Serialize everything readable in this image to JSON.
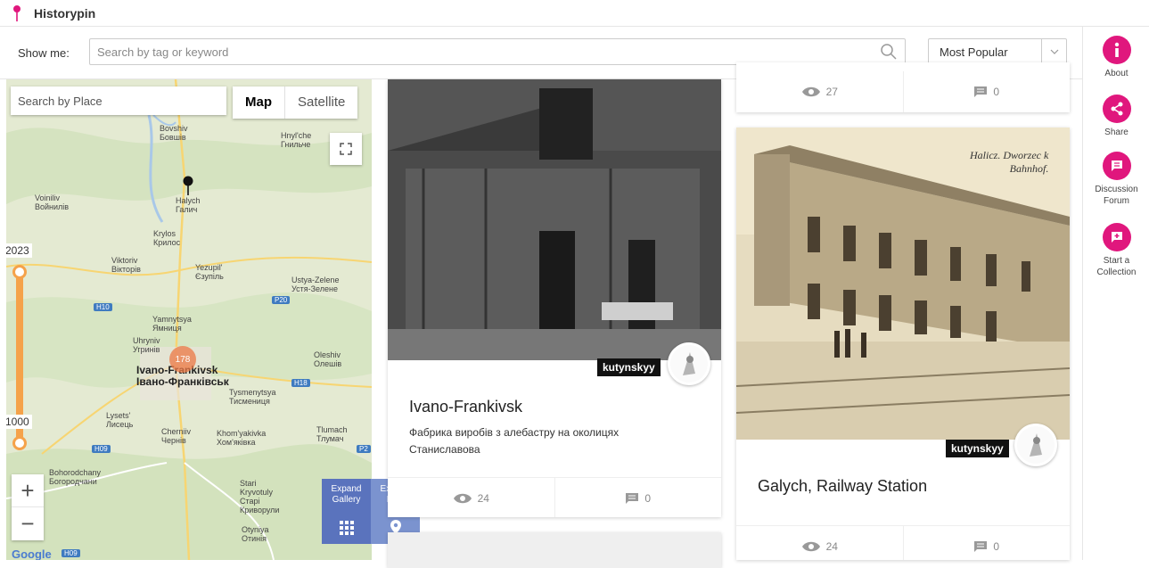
{
  "app": {
    "title": "Historypin"
  },
  "search": {
    "label": "Show me:",
    "placeholder": "Search by tag or keyword",
    "sort_value": "Most Popular"
  },
  "rail": [
    {
      "label": "About",
      "icon": "info-icon"
    },
    {
      "label": "Share",
      "icon": "share-icon"
    },
    {
      "label": "Discussion\nForum",
      "icon": "chat-icon"
    },
    {
      "label": "Start a\nCollection",
      "icon": "add-collection-icon"
    }
  ],
  "map": {
    "place_search_placeholder": "Search by Place",
    "type_map": "Map",
    "type_satellite": "Satellite",
    "year_top": "2023",
    "year_bottom": "1000",
    "cluster_count": "178",
    "google": "Google",
    "places": [
      "Bovshiv\nБовшів",
      "Hnyl'che\nГнильче",
      "Voiniliv\nВойнилів",
      "Halych\nГалич",
      "Krylos\nКрилос",
      "Viktoriv\nВікторів",
      "Yezupil'\nЄзупіль",
      "Ustya-Zelene\nУстя-Зелене",
      "Yamnytsya\nЯмниця",
      "Uhryniv\nУгринів",
      "Ivano-Frankivsk\nІвано-Франківськ",
      "Oleshiv\nОлешів",
      "Tysmenytsya\nТисмениця",
      "Lysets'\nЛисець",
      "Cherniiv\nЧернів",
      "Khom'yakivka\nХом'яківка",
      "Tlumach\nТлумач",
      "Bohorodchany\nБогородчани",
      "Stari\nKryvotuly\nСтарі\nКриворули",
      "Otyniya\nОтинія"
    ],
    "roads": [
      "H10",
      "P20",
      "H18",
      "H09",
      "P2",
      "H09"
    ]
  },
  "expand": {
    "gallery": "Expand\nGallery",
    "map": "Expand\nMap"
  },
  "cards": [
    {
      "author": "kutynskyy",
      "title": "Ivano-Frankivsk",
      "description": "Фабрика виробів з алебастру на околицях Станиславова",
      "views": "24",
      "comments": "0"
    },
    {
      "views": "27",
      "comments": "0"
    },
    {
      "author": "kutynskyy",
      "title": "Galych, Railway Station",
      "views": "24",
      "comments": "0",
      "image_caption": "Halicz. Dworzec k\nBahnhof."
    }
  ]
}
